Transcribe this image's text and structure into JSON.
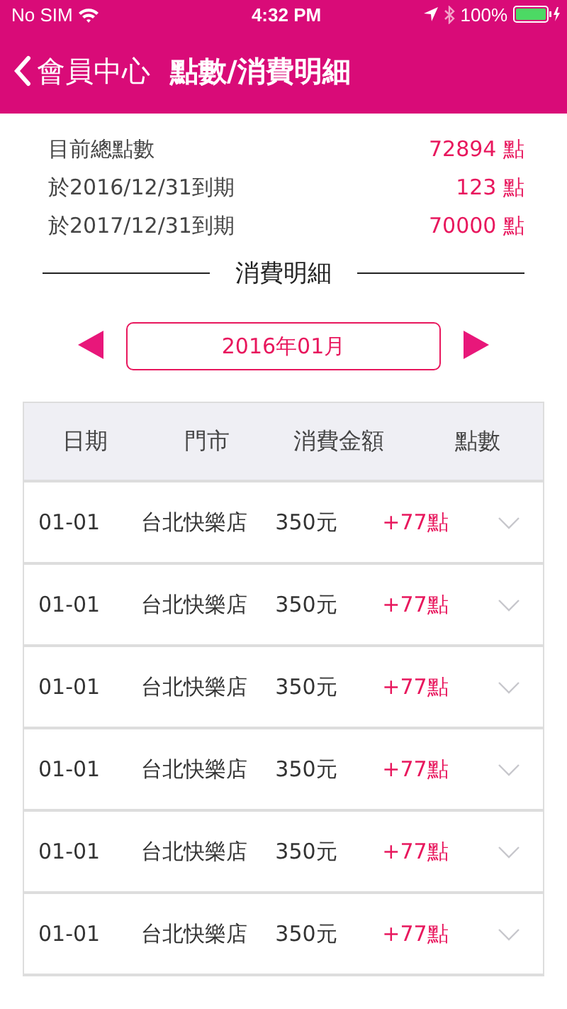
{
  "status_bar": {
    "carrier": "No SIM",
    "time": "4:32 PM",
    "battery": "100%"
  },
  "nav": {
    "back": "會員中心",
    "title": "點數/消費明細"
  },
  "summary": [
    {
      "label": "目前總點數",
      "value": "72894 點"
    },
    {
      "label": "於2016/12/31到期",
      "value": "123 點"
    },
    {
      "label": "於2017/12/31到期",
      "value": "70000 點"
    }
  ],
  "section_title": "消費明細",
  "month": "2016年01月",
  "table": {
    "columns": [
      "日期",
      "門市",
      "消費金額",
      "點數"
    ],
    "rows": [
      {
        "date": "01-01",
        "store": "台北快樂店",
        "amount": "350元",
        "points": "+77點",
        "expanded": false
      },
      {
        "date": "01-01",
        "store": "台北快樂店",
        "amount": "350元",
        "points": "+77點",
        "expanded": false
      },
      {
        "date": "01-01",
        "store": "台北快樂店",
        "amount": "350元",
        "points": "+77點",
        "expanded": false
      },
      {
        "date": "01-01",
        "store": "台北快樂店",
        "amount": "350元",
        "points": "+77點",
        "expanded": false
      },
      {
        "date": "01-01",
        "store": "台北快樂店",
        "amount": "350元",
        "points": "+77點",
        "expanded": false
      },
      {
        "date": "01-01",
        "store": "台北快樂店",
        "amount": "350元",
        "points": "+77點",
        "expanded": false
      }
    ]
  }
}
